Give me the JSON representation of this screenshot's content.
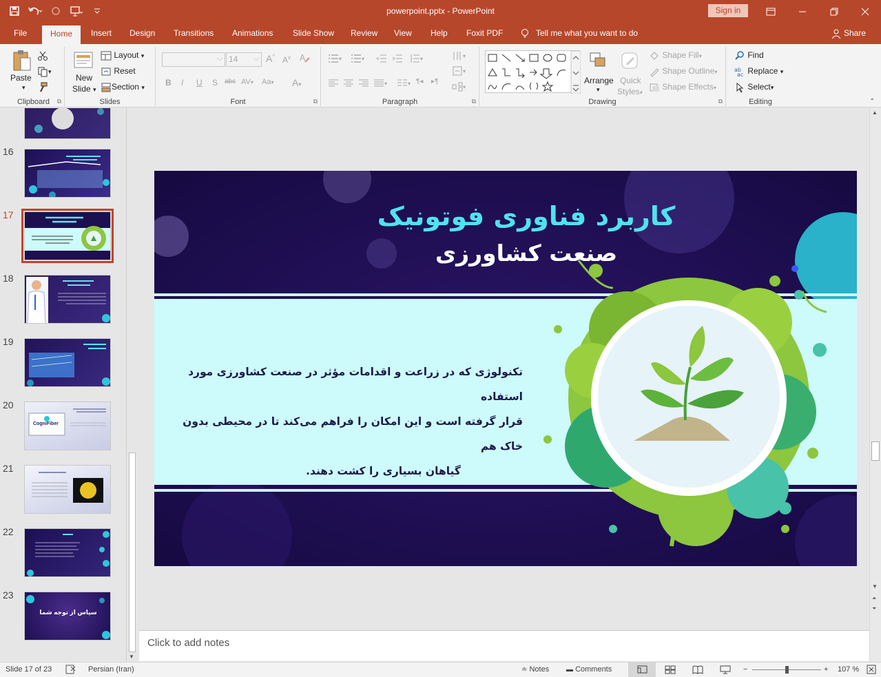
{
  "window": {
    "title": "powerpoint.pptx  -  PowerPoint",
    "sign_in": "Sign in"
  },
  "tabs": [
    "File",
    "Home",
    "Insert",
    "Design",
    "Transitions",
    "Animations",
    "Slide Show",
    "Review",
    "View",
    "Help",
    "Foxit PDF"
  ],
  "active_tab": "Home",
  "tell_me": "Tell me what you want to do",
  "share": "Share",
  "ribbon": {
    "clipboard": {
      "label": "Clipboard",
      "paste": "Paste"
    },
    "slides": {
      "label": "Slides",
      "new_slide_1": "New",
      "new_slide_2": "Slide",
      "layout": "Layout",
      "reset": "Reset",
      "section": "Section"
    },
    "font": {
      "label": "Font",
      "size": "14",
      "bold": "B",
      "italic": "I",
      "underline": "U",
      "shadow": "S",
      "strike": "abc"
    },
    "paragraph": {
      "label": "Paragraph"
    },
    "drawing": {
      "label": "Drawing",
      "arrange": "Arrange",
      "quick_styles_1": "Quick",
      "quick_styles_2": "Styles",
      "shape_fill": "Shape Fill",
      "shape_outline": "Shape Outline",
      "shape_effects": "Shape Effects"
    },
    "editing": {
      "label": "Editing",
      "find": "Find",
      "replace": "Replace",
      "select": "Select"
    }
  },
  "thumbnails": [
    {
      "num": "16",
      "text": ""
    },
    {
      "num": "17",
      "text": ""
    },
    {
      "num": "18",
      "text": ""
    },
    {
      "num": "19",
      "text": ""
    },
    {
      "num": "20",
      "text": "CogniFiber"
    },
    {
      "num": "21",
      "text": ""
    },
    {
      "num": "22",
      "text": ""
    },
    {
      "num": "23",
      "text": "سپاس از توجه شما"
    }
  ],
  "slide": {
    "title": "کاربرد فناوری فوتونیک",
    "subtitle": "صنعت کشاورزی",
    "body_line1": "تکنولوژی که در زراعت و اقدامات مؤثر در صنعت کشاورزی مورد استفاده",
    "body_line2": "قرار گرفته است و این امکان را فراهم می‌کند تا در محیطی بدون خاک هم",
    "body_line3": "گیاهان بسیاری را کشت دهند."
  },
  "notes_placeholder": "Click to add notes",
  "status": {
    "slide_info": "Slide 17 of 23",
    "language": "Persian (Iran)",
    "notes": "Notes",
    "comments": "Comments",
    "zoom": "107 %"
  },
  "colors": {
    "accent": "#b7472a",
    "slide_dark": "#1e0f50",
    "slide_cyan": "#4fe3ee",
    "band": "#cdfafa"
  }
}
